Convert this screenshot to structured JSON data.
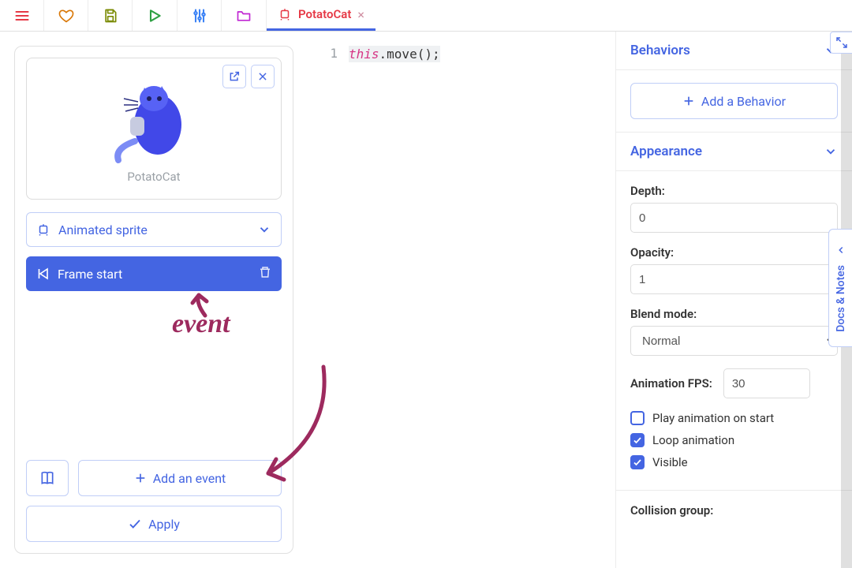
{
  "tab": {
    "label": "PotatoCat",
    "close": "×"
  },
  "left": {
    "spriteName": "PotatoCat",
    "typeSelect": "Animated sprite",
    "eventName": "Frame start",
    "addEvent": "Add an event",
    "apply": "Apply"
  },
  "code": {
    "lineNo": "1",
    "kw": "this",
    "rest": ".move();"
  },
  "right": {
    "behaviors": {
      "title": "Behaviors",
      "addBtn": "Add a Behavior"
    },
    "appearance": {
      "title": "Appearance",
      "depthLabel": "Depth:",
      "depthValue": "0",
      "opacityLabel": "Opacity:",
      "opacityValue": "1",
      "blendLabel": "Blend mode:",
      "blendValue": "Normal",
      "fpsLabel": "Animation FPS:",
      "fpsValue": "30",
      "playOnStart": "Play animation on start",
      "loop": "Loop animation",
      "visible": "Visible"
    },
    "collision": {
      "title": "Collision group:"
    }
  },
  "annotation": {
    "text": "event"
  },
  "docsTab": {
    "label": "Docs & Notes"
  }
}
